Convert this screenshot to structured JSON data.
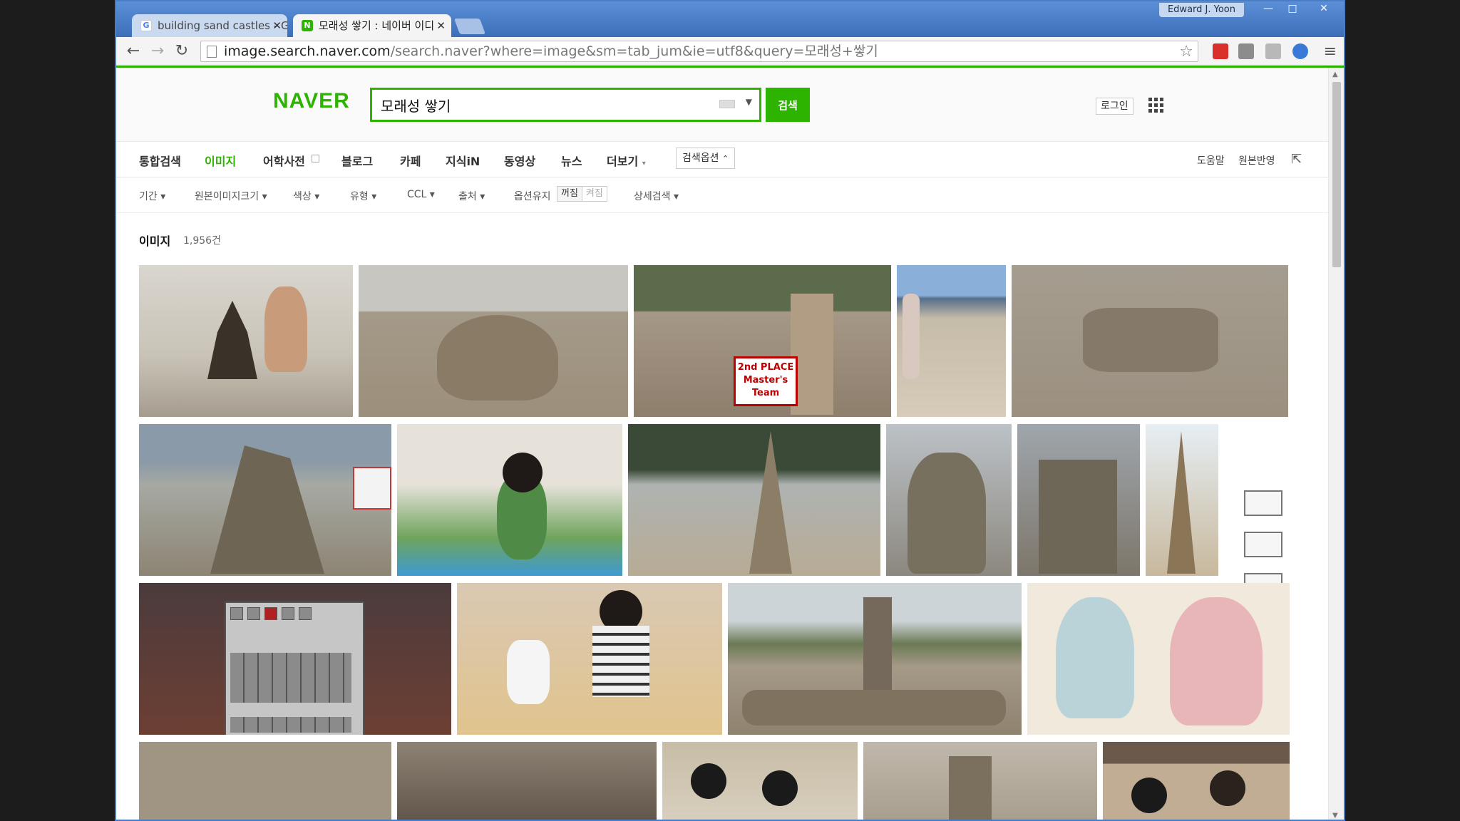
{
  "browser": {
    "user_label": "Edward J. Yoon",
    "window_buttons": [
      "—",
      "□",
      "✕"
    ],
    "tabs": [
      {
        "title": "building sand castles - G",
        "active": false,
        "favicon": "google-icon"
      },
      {
        "title": "모래성 쌓기 : 네이버 이디",
        "active": true,
        "favicon": "naver-icon"
      }
    ],
    "close_glyph": "✕",
    "url_host": "image.search.naver.com",
    "url_path": "/search.naver?where=image&sm=tab_jum&ie=utf8&query=모래성+쌓기",
    "back_glyph": "←",
    "forward_glyph": "→",
    "reload_glyph": "↻",
    "star_glyph": "☆",
    "menu_glyph": "≡"
  },
  "header": {
    "logo": "NAVER",
    "search_value": "모래성 쌓기",
    "search_button": "검색",
    "login": "로그인"
  },
  "nav": {
    "tabs": [
      "통합검색",
      "이미지",
      "어학사전",
      "블로그",
      "카페",
      "지식iN",
      "동영상",
      "뉴스",
      "더보기"
    ],
    "active": "이미지",
    "options": "검색옵션",
    "help": "도움말",
    "feedback": "원본반영"
  },
  "filters": {
    "items": [
      "기간",
      "원본이미지크기",
      "색상",
      "유형",
      "CCL",
      "출처"
    ],
    "keep_label": "옵션유지",
    "keep_off": "꺼짐",
    "keep_on": "켜짐",
    "advanced": "상세검색"
  },
  "results": {
    "title": "이미지",
    "count": "1,956건",
    "badge_text": "2nd PLACE Master's Team"
  },
  "colors": {
    "accent": "#2db400",
    "chrome_blue": "#3c6fb8"
  }
}
